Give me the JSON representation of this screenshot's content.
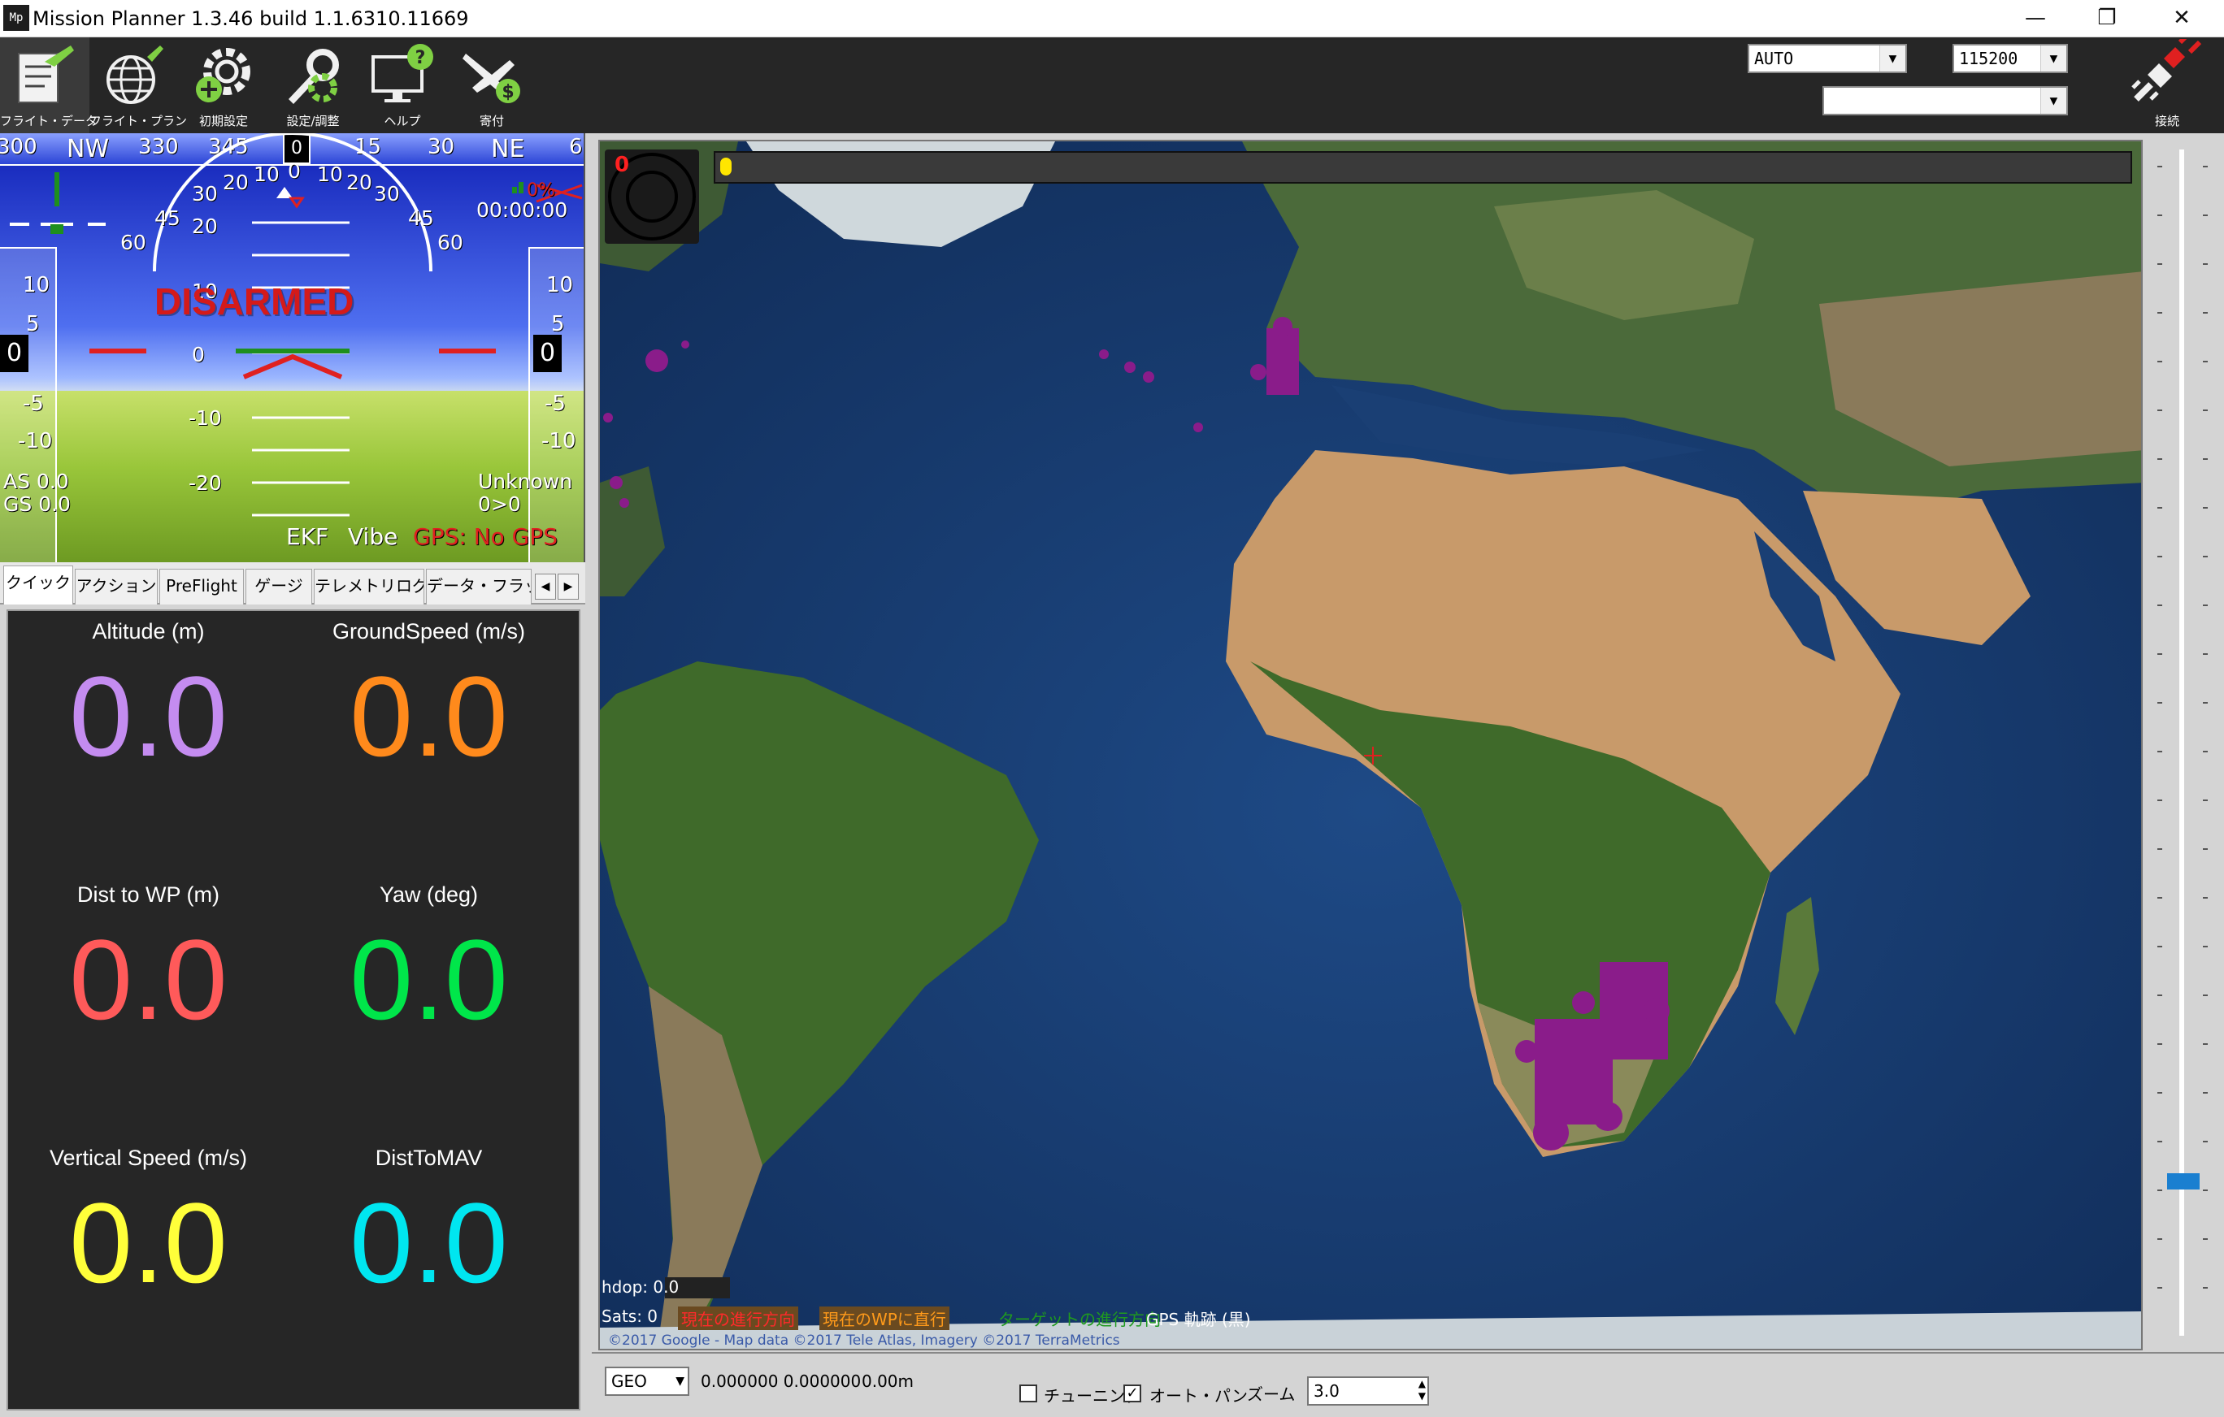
{
  "window": {
    "title": "Mission Planner 1.3.46 build 1.1.6310.11669",
    "icon_text": "Mp",
    "minimize": "—",
    "restore": "❐",
    "close": "✕"
  },
  "toolbar": {
    "items": [
      {
        "label": "フライト・データ",
        "icon": "flight-data-icon"
      },
      {
        "label": "フライト・プラン",
        "icon": "flight-plan-icon"
      },
      {
        "label": "初期設定",
        "icon": "initial-setup-icon"
      },
      {
        "label": "設定/調整",
        "icon": "config-tuning-icon"
      },
      {
        "label": "ヘルプ",
        "icon": "help-icon"
      },
      {
        "label": "寄付",
        "icon": "donate-icon"
      }
    ],
    "mode_select": "AUTO",
    "baud_select": "115200",
    "port_select": "",
    "connect_label": "接続"
  },
  "hud": {
    "heading_labels": [
      "300",
      "NW",
      "330",
      "345",
      "0",
      "15",
      "30",
      "NE",
      "6"
    ],
    "heading_value": "0",
    "pitch_labels": [
      "20",
      "10",
      "0",
      "-10",
      "-20"
    ],
    "roll_labels": [
      "60",
      "45",
      "30",
      "20",
      "10",
      "0",
      "10",
      "20",
      "30",
      "45",
      "60"
    ],
    "speed_tape": [
      "10",
      "5",
      "-5",
      "-10"
    ],
    "speed_value": "0",
    "alt_tape": [
      "10",
      "5",
      "-5",
      "-10"
    ],
    "alt_value": "0",
    "status": "DISARMED",
    "battery_percent": "0%",
    "timer": "00:00:00",
    "airspeed": "AS 0.0",
    "groundspeed": "GS 0.0",
    "mode_text": "Unknown",
    "wp_text": "0>0",
    "ekf": "EKF",
    "vibe": "Vibe",
    "gps": "GPS: No GPS"
  },
  "tabs": [
    {
      "label": "クイック",
      "active": true
    },
    {
      "label": "アクション",
      "active": false
    },
    {
      "label": "PreFlight",
      "active": false
    },
    {
      "label": "ゲージ",
      "active": false
    },
    {
      "label": "テレメトリログ",
      "active": false
    },
    {
      "label": "データ・フラッシ",
      "active": false
    }
  ],
  "quick": [
    {
      "label": "Altitude (m)",
      "value": "0.0",
      "color": "#c48cf0"
    },
    {
      "label": "GroundSpeed (m/s)",
      "value": "0.0",
      "color": "#ff8a1c"
    },
    {
      "label": "Dist to WP (m)",
      "value": "0.0",
      "color": "#ff5a5a"
    },
    {
      "label": "Yaw (deg)",
      "value": "0.0",
      "color": "#00e64a"
    },
    {
      "label": "Vertical Speed (m/s)",
      "value": "0.0",
      "color": "#ffff3a"
    },
    {
      "label": "DistToMAV",
      "value": "0.0",
      "color": "#00e6f0"
    }
  ],
  "map": {
    "top_counter": "0",
    "hdop": "hdop: 0.0",
    "sats": "Sats: 0",
    "legend": [
      {
        "text": "現在の進行方向",
        "color": "#ff2a2a"
      },
      {
        "text": "現在のWPに直行",
        "color": "#ff9a1a"
      },
      {
        "text": "ターゲットの進行方向",
        "color": "#1f9a1f"
      },
      {
        "text": "GPS 軌跡 (黒)",
        "color": "#ffffff"
      }
    ],
    "attribution": "©2017 Google - Map data ©2017 Tele Atlas, Imagery ©2017 TerraMetrics"
  },
  "bottom": {
    "coord_system": "GEO",
    "coords": "0.000000 0.000000",
    "altitude": "0.00m",
    "tuning_label": "チューニング",
    "tuning_checked": false,
    "autopan_label": "オート・パン",
    "autopan_checked": true,
    "zoom_label": "ズーム",
    "zoom_value": "3.0"
  }
}
